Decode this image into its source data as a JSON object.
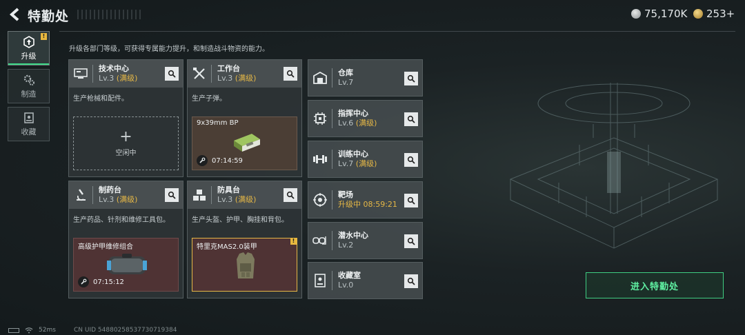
{
  "header": {
    "title": "特勤处",
    "currency": [
      {
        "icon": "silver-coin-icon",
        "value": "75,170K"
      },
      {
        "icon": "gold-coin-icon",
        "value": "253+"
      }
    ]
  },
  "tabs": [
    {
      "label": "升级",
      "icon": "upgrade-icon",
      "badge": "!"
    },
    {
      "label": "制造",
      "icon": "gears-icon"
    },
    {
      "label": "收藏",
      "icon": "collection-icon"
    }
  ],
  "description": "升级各部门等级，可获得专属能力提升，和制造战斗物资的能力。",
  "cards": [
    {
      "name": "技术中心",
      "level": "Lv.3",
      "max": "(满级)",
      "desc": "生产枪械和配件。",
      "slot": {
        "type": "empty",
        "plus": "+",
        "label": "空闲中"
      }
    },
    {
      "name": "工作台",
      "level": "Lv.3",
      "max": "(满级)",
      "desc": "生产子弹。",
      "slot": {
        "type": "item",
        "label": "9x39mm BP",
        "timer": "07:14:59"
      }
    },
    {
      "name": "制药台",
      "level": "Lv.3",
      "max": "(满级)",
      "desc": "生产药品、针剂和维修工具包。",
      "slot": {
        "type": "item",
        "label": "高级护甲维修组合",
        "timer": "07:15:12"
      }
    },
    {
      "name": "防具台",
      "level": "Lv.3",
      "max": "(满级)",
      "desc": "生产头盔、护甲、胸挂和背包。",
      "slot": {
        "type": "item",
        "label": "特里克MAS2.0装甲",
        "badge": "!"
      }
    }
  ],
  "facilities": [
    {
      "name": "仓库",
      "level": "Lv.7",
      "max": ""
    },
    {
      "name": "指挥中心",
      "level": "Lv.6",
      "max": "(满级)"
    },
    {
      "name": "训练中心",
      "level": "Lv.7",
      "max": "(满级)"
    },
    {
      "name": "靶场",
      "level": "升级中",
      "timer": "08:59:21"
    },
    {
      "name": "潜水中心",
      "level": "Lv.2",
      "max": ""
    },
    {
      "name": "收藏室",
      "level": "Lv.0",
      "max": ""
    }
  ],
  "enter_button": "进入特勤处",
  "footer": {
    "ping": "52ms",
    "uid": "CN UID 54880258537730719384"
  },
  "colors": {
    "accent_green": "#3fdc8a",
    "max_gold": "#e6b846"
  }
}
